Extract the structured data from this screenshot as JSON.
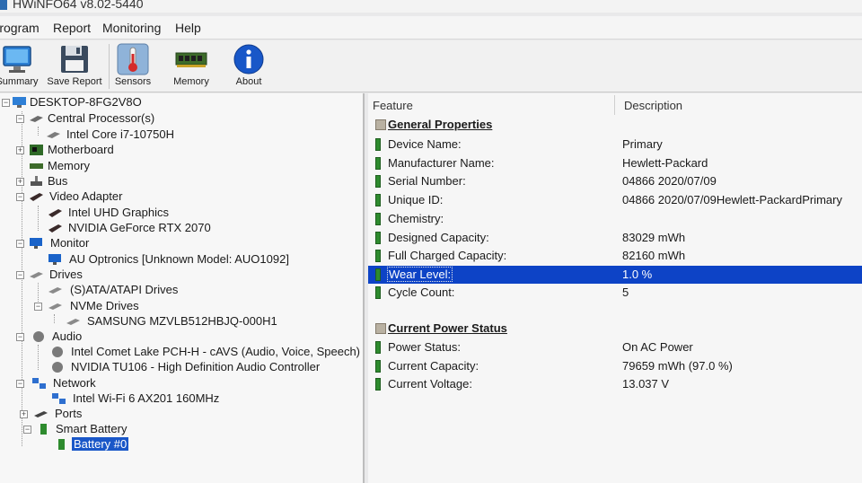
{
  "window": {
    "title": "HWiNFO64 v8.02-5440"
  },
  "menu": [
    "Program",
    "Report",
    "Monitoring",
    "Help"
  ],
  "toolbar": [
    {
      "label": "Summary",
      "icon": "monitor-icon"
    },
    {
      "label": "Save Report",
      "icon": "floppy-disk-icon"
    },
    {
      "label": "Sensors",
      "icon": "thermometer-icon"
    },
    {
      "label": "Memory",
      "icon": "memory-module-icon"
    },
    {
      "label": "About",
      "icon": "info-icon"
    }
  ],
  "tree": {
    "root": "DESKTOP-8FG2V8O",
    "items": [
      {
        "label": "Central Processor(s)",
        "icon": "cpu-icon",
        "expander": "−"
      },
      {
        "label": "Intel Core i7-10750H",
        "icon": "cpu-chip-icon",
        "expander": ""
      },
      {
        "label": "Motherboard",
        "icon": "motherboard-icon",
        "expander": "+"
      },
      {
        "label": "Memory",
        "icon": "memory-icon",
        "expander": ""
      },
      {
        "label": "Bus",
        "icon": "bus-icon",
        "expander": "+"
      },
      {
        "label": "Video Adapter",
        "icon": "video-adapter-icon",
        "expander": "−"
      },
      {
        "label": "Intel UHD Graphics",
        "icon": "graphics-card-icon",
        "expander": ""
      },
      {
        "label": "NVIDIA GeForce RTX 2070",
        "icon": "graphics-card-icon",
        "expander": ""
      },
      {
        "label": "Monitor",
        "icon": "monitor-icon",
        "expander": "−"
      },
      {
        "label": "AU Optronics [Unknown Model: AUO1092]",
        "icon": "monitor-icon",
        "expander": ""
      },
      {
        "label": "Drives",
        "icon": "drives-icon",
        "expander": "−"
      },
      {
        "label": "(S)ATA/ATAPI Drives",
        "icon": "drive-icon",
        "expander": ""
      },
      {
        "label": "NVMe Drives",
        "icon": "drive-icon",
        "expander": "−"
      },
      {
        "label": "SAMSUNG MZVLB512HBJQ-000H1",
        "icon": "drive-icon",
        "expander": ""
      },
      {
        "label": "Audio",
        "icon": "audio-icon",
        "expander": "−"
      },
      {
        "label": "Intel Comet Lake PCH-H - cAVS (Audio, Voice, Speech) [A",
        "icon": "audio-device-icon",
        "expander": ""
      },
      {
        "label": "NVIDIA TU106 - High Definition Audio Controller",
        "icon": "audio-device-icon",
        "expander": ""
      },
      {
        "label": "Network",
        "icon": "network-icon",
        "expander": "−"
      },
      {
        "label": "Intel Wi-Fi 6 AX201 160MHz",
        "icon": "network-adapter-icon",
        "expander": ""
      },
      {
        "label": "Ports",
        "icon": "ports-icon",
        "expander": "+"
      },
      {
        "label": "Smart Battery",
        "icon": "battery-icon",
        "expander": "−"
      },
      {
        "label": "Battery #0",
        "icon": "battery-icon",
        "expander": ""
      }
    ]
  },
  "details": {
    "columns": {
      "feature": "Feature",
      "description": "Description"
    },
    "sections": [
      {
        "title": "General Properties",
        "rows": [
          {
            "feature": "Device Name:",
            "value": "Primary"
          },
          {
            "feature": "Manufacturer Name:",
            "value": "Hewlett-Packard"
          },
          {
            "feature": "Serial Number:",
            "value": "04866 2020/07/09"
          },
          {
            "feature": "Unique ID:",
            "value": "04866 2020/07/09Hewlett-PackardPrimary"
          },
          {
            "feature": "Chemistry:",
            "value": ""
          },
          {
            "feature": "Designed Capacity:",
            "value": "83029 mWh"
          },
          {
            "feature": "Full Charged Capacity:",
            "value": "82160 mWh"
          },
          {
            "feature": "Wear Level:",
            "value": "1.0 %"
          },
          {
            "feature": "Cycle Count:",
            "value": "5"
          }
        ]
      },
      {
        "title": "Current Power Status",
        "rows": [
          {
            "feature": "Power Status:",
            "value": "On AC Power"
          },
          {
            "feature": "Current Capacity:",
            "value": "79659 mWh (97.0 %)"
          },
          {
            "feature": "Current Voltage:",
            "value": "13.037 V"
          }
        ]
      }
    ]
  },
  "colors": {
    "selection": "#0d43c6",
    "tree_selection": "#1a57c8",
    "row_icon": "#2e8b2e"
  }
}
